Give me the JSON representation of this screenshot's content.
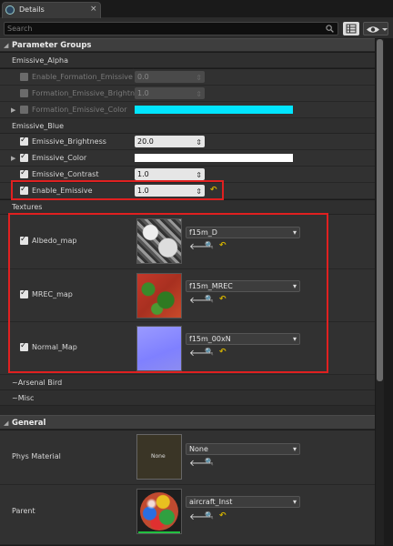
{
  "window": {
    "tab_title": "Details",
    "tab_close": "×"
  },
  "search": {
    "placeholder": "Search"
  },
  "panel": {
    "parameter_groups_label": "Parameter Groups",
    "general_label": "General"
  },
  "emissive_alpha": {
    "label": "Emissive_Alpha",
    "props": [
      {
        "label": "Enable_Formation_Emissive",
        "value": "0.0"
      },
      {
        "label": "Formation_Emissive_Brightne",
        "value": "1.0"
      },
      {
        "label": "Formation_Emissive_Color",
        "color": "#00e5ff"
      }
    ]
  },
  "emissive_blue": {
    "label": "Emissive_Blue",
    "props": [
      {
        "label": "Emissive_Brightness",
        "value": "20.0"
      },
      {
        "label": "Emissive_Color",
        "color": "#ffffff"
      },
      {
        "label": "Emissive_Contrast",
        "value": "1.0"
      },
      {
        "label": "Enable_Emissive",
        "value": "1.0"
      }
    ]
  },
  "textures": {
    "label": "Textures",
    "items": [
      {
        "label": "Albedo_map",
        "asset": "f15m_D"
      },
      {
        "label": "MREC_map",
        "asset": "f15m_MREC"
      },
      {
        "label": "Normal_Map",
        "asset": "f15m_00xN"
      }
    ]
  },
  "collapsed_groups": [
    "~Arsenal Bird",
    "~Misc"
  ],
  "general": {
    "phys_material": {
      "label": "Phys Material",
      "value": "None",
      "thumb_text": "None"
    },
    "parent": {
      "label": "Parent",
      "value": "aircraft_Inst"
    }
  },
  "icons": {
    "drag": "⇕",
    "reset": "↶",
    "use_selected": "🡐",
    "browse": "🔍",
    "expand_open": "◢",
    "expand_closed": "▶",
    "dropdown": "▾"
  },
  "colors": {
    "accent_highlight": "#e02020",
    "reset_arrow": "#d6b400",
    "formation_color": "#00e5ff",
    "emissive_color": "#ffffff"
  }
}
